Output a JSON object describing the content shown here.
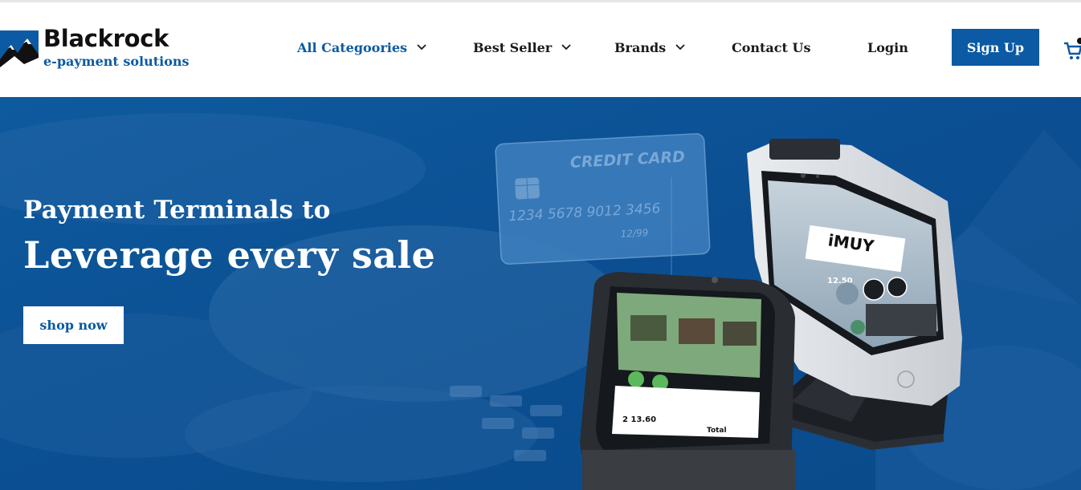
{
  "brand": {
    "name": "Blackrock",
    "tagline": "e-payment solutions",
    "colors": {
      "primary": "#0b5aa3",
      "dark": "#111111",
      "hero_bg": "#0c5296"
    }
  },
  "nav": {
    "items": [
      {
        "label": "All Categoories",
        "has_dropdown": true,
        "active": true
      },
      {
        "label": "Best Seller",
        "has_dropdown": true,
        "active": false
      },
      {
        "label": "Brands",
        "has_dropdown": true,
        "active": false
      },
      {
        "label": "Contact Us",
        "has_dropdown": false,
        "active": false
      },
      {
        "label": "Login",
        "has_dropdown": false,
        "active": false
      }
    ],
    "signup_label": "Sign Up",
    "cart_icon": "cart-icon"
  },
  "hero": {
    "subtitle": "Payment Terminals to",
    "title": "Leverage every sale",
    "cta_label": "shop now",
    "card": {
      "label": "CREDIT CARD",
      "number": "1234 5678 9012 3456",
      "expiry": "12/99"
    },
    "terminal_screen": {
      "brand_text": "iMUY",
      "price": "12.50",
      "total": "Total",
      "total_value": "2 13.60"
    }
  }
}
